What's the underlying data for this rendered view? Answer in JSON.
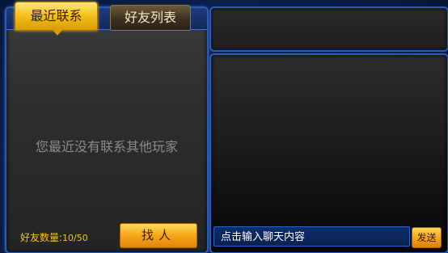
{
  "tabs": {
    "recent_label": "最近联系",
    "friends_label": "好友列表"
  },
  "contacts": {
    "empty_message": "您最近没有联系其他玩家",
    "friend_count_label": "好友数量:",
    "friend_count_value": "10/50",
    "find_button_label": "找人"
  },
  "chat": {
    "input_placeholder": "点击输入聊天内容",
    "send_button_label": "发送"
  },
  "colors": {
    "accent_gold": "#f5c21a",
    "panel_border_blue": "#2a5db8",
    "count_text": "#f2c31a"
  }
}
